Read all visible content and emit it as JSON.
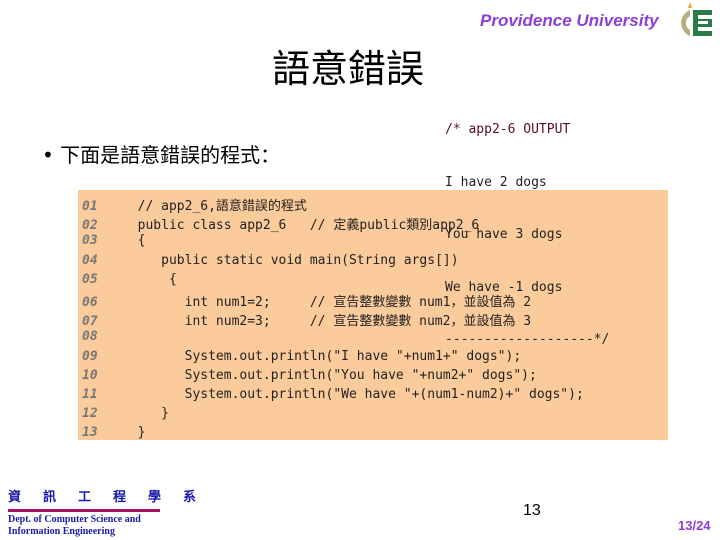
{
  "header": {
    "brand": "Providence University"
  },
  "slide": {
    "title": "語意錯誤",
    "bullet": "• 下面是語意錯誤的程式："
  },
  "output": {
    "lines": [
      "/* app2-6 OUTPUT",
      "I have 2 dogs",
      "You have 3 dogs",
      "We have -1 dogs",
      "-------------------*/"
    ]
  },
  "code": {
    "lines": [
      {
        "n": "01",
        "t": "  // app2_6,語意錯誤的程式"
      },
      {
        "n": "02",
        "t": "  public class app2_6   // 定義public類別app2_6"
      },
      {
        "n": "03",
        "t": "  {"
      },
      {
        "n": "04",
        "t": "     public static void main(String args[])"
      },
      {
        "n": "05",
        "t": "      {"
      },
      {
        "n": "06",
        "t": "        int num1=2;     // 宣告整數變數 num1，並設值為 2"
      },
      {
        "n": "07",
        "t": "        int num2=3;     // 宣告整數變數 num2，並設值為 3"
      },
      {
        "n": "08",
        "t": ""
      },
      {
        "n": "09",
        "t": "        System.out.println(\"I have \"+num1+\" dogs\");"
      },
      {
        "n": "10",
        "t": "        System.out.println(\"You have \"+num2+\" dogs\");"
      },
      {
        "n": "11",
        "t": "        System.out.println(\"We have \"+(num1-num2)+\" dogs\");"
      },
      {
        "n": "12",
        "t": "     }"
      },
      {
        "n": "13",
        "t": "  }"
      }
    ]
  },
  "footer": {
    "dept_cn": "資訊工程學系",
    "dept_en1": "Dept. of Computer Science and",
    "dept_en2": "Information Engineering",
    "page": "13",
    "page_of": "13/24"
  },
  "colors": {
    "brand": "#8b3fd6",
    "code_bg": "#fccb9c",
    "dept": "#1a1aa8"
  }
}
